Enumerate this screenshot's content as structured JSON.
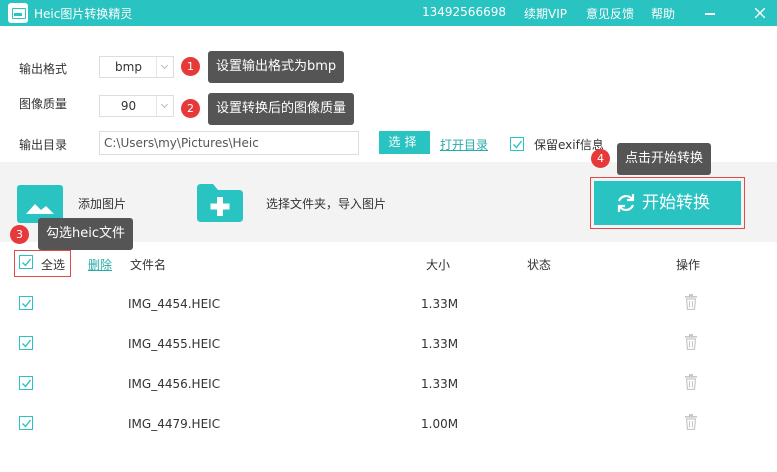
{
  "titlebar": {
    "app_title": "Heic图片转换精灵",
    "phone": "13492566698",
    "vip": "续期VIP",
    "feedback": "意见反馈",
    "help": "帮助"
  },
  "settings": {
    "format_label": "输出格式",
    "format_value": "bmp",
    "quality_label": "图像质量",
    "quality_value": "90",
    "dir_label": "输出目录",
    "dir_value": "C:\\Users\\my\\Pictures\\Heic",
    "choose_label": "选择",
    "open_dir_label": "打开目录",
    "keep_exif_label": "保留exif信息",
    "keep_exif_checked": true
  },
  "actions": {
    "add_image": "添加图片",
    "choose_folder": "选择文件夹，导入图片",
    "start": "开始转换"
  },
  "annotations": [
    {
      "num": "1",
      "text": "设置输出格式为bmp"
    },
    {
      "num": "2",
      "text": "设置转换后的图像质量"
    },
    {
      "num": "3",
      "text": "勾选heic文件"
    },
    {
      "num": "4",
      "text": "点击开始转换"
    }
  ],
  "table": {
    "select_all": "全选",
    "delete": "删除",
    "col_name": "文件名",
    "col_size": "大小",
    "col_status": "状态",
    "col_action": "操作",
    "rows": [
      {
        "name": "IMG_4454.HEIC",
        "size": "1.33M",
        "status": "",
        "checked": true
      },
      {
        "name": "IMG_4455.HEIC",
        "size": "1.33M",
        "status": "",
        "checked": true
      },
      {
        "name": "IMG_4456.HEIC",
        "size": "1.33M",
        "status": "",
        "checked": true
      },
      {
        "name": "IMG_4479.HEIC",
        "size": "1.00M",
        "status": "",
        "checked": true
      }
    ]
  },
  "colors": {
    "accent": "#29c3c1",
    "annotation_red": "#e6393a",
    "tooltip_bg": "#555555"
  }
}
